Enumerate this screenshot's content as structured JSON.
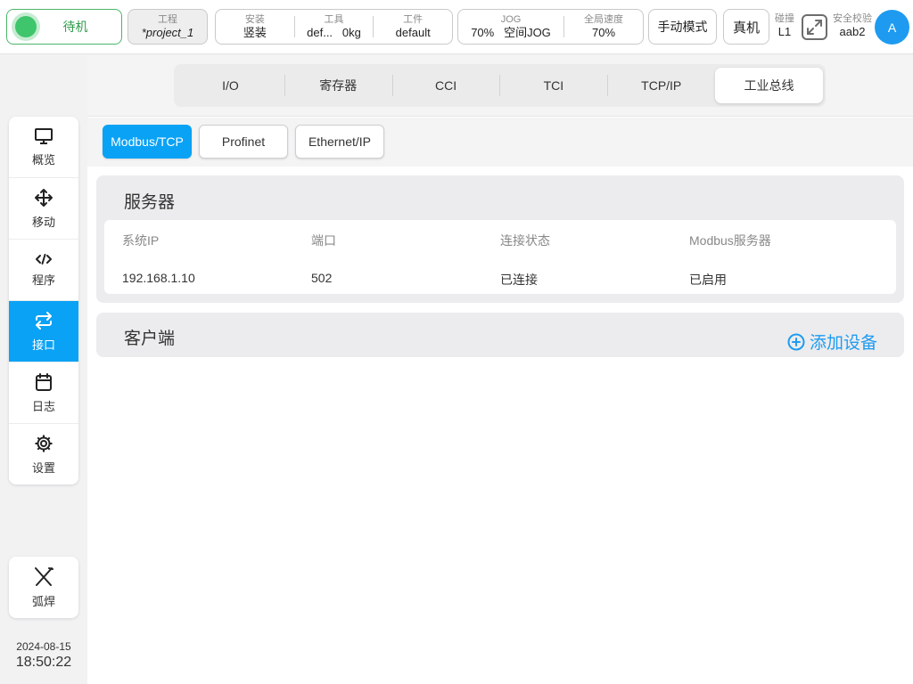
{
  "topbar": {
    "status": "待机",
    "project": {
      "caption": "工程",
      "value": "*project_1"
    },
    "install": {
      "caption": "安装",
      "value": "竖装"
    },
    "tool": {
      "caption": "工具",
      "name": "def...",
      "load": "0kg"
    },
    "workpiece": {
      "caption": "工件",
      "value": "default"
    },
    "jog": {
      "caption": "JOG",
      "speed": "70%",
      "mode": "空间JOG"
    },
    "global_speed": {
      "caption": "全局速度",
      "value": "70%"
    },
    "manual_mode": "手动模式",
    "real_machine": "真机",
    "collision": {
      "caption": "碰撞",
      "value": "L1"
    },
    "safety": {
      "caption": "安全校验",
      "value": "aab2"
    },
    "user_avatar": "A"
  },
  "sidebar": {
    "items": [
      {
        "label": "概览",
        "icon": "monitor-icon"
      },
      {
        "label": "移动",
        "icon": "move-icon"
      },
      {
        "label": "程序",
        "icon": "code-icon"
      },
      {
        "label": "接口",
        "icon": "interface-icon"
      },
      {
        "label": "日志",
        "icon": "calendar-icon"
      },
      {
        "label": "设置",
        "icon": "gear-icon"
      }
    ],
    "active_index": 3,
    "weld": {
      "label": "弧焊",
      "icon": "welding-torch-icon"
    },
    "date": "2024-08-15",
    "time": "18:50:22"
  },
  "tabs": [
    "I/O",
    "寄存器",
    "CCI",
    "TCI",
    "TCP/IP",
    "工业总线"
  ],
  "active_tab": 5,
  "subtabs": [
    "Modbus/TCP",
    "Profinet",
    "Ethernet/IP"
  ],
  "active_subtab": 0,
  "server": {
    "title": "服务器",
    "columns": [
      "系统IP",
      "端口",
      "连接状态",
      "Modbus服务器"
    ],
    "row": [
      "192.168.1.10",
      "502",
      "已连接",
      "已启用"
    ]
  },
  "client": {
    "title": "客户端",
    "add_label": "添加设备"
  },
  "colors": {
    "accent": "#0aa2f5",
    "status_green": "#3fc56b",
    "link_blue": "#1e9bf0"
  }
}
